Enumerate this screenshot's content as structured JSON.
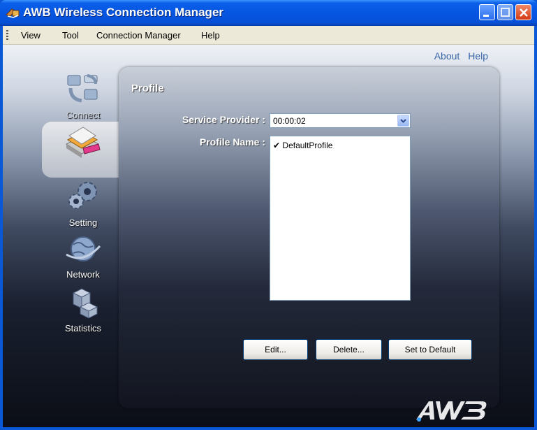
{
  "window": {
    "title": "AWB Wireless Connection Manager",
    "title_icon": "app-icon"
  },
  "menu": {
    "items": [
      "View",
      "Tool",
      "Connection Manager",
      "Help"
    ]
  },
  "toplinks": {
    "about": "About",
    "help": "Help"
  },
  "nav": {
    "items": [
      {
        "label": "Connect",
        "icon": "connect-icon"
      },
      {
        "label": "",
        "icon": "profile-icon",
        "selected": true
      },
      {
        "label": "Setting",
        "icon": "gear-icon"
      },
      {
        "label": "Network",
        "icon": "globe-icon"
      },
      {
        "label": "Statistics",
        "icon": "statistics-icon"
      }
    ]
  },
  "panel": {
    "title": "Profile",
    "service_provider_label": "Service Provider :",
    "service_provider_value": "00:00:02",
    "profile_name_label": "Profile Name :",
    "profiles": [
      "DefaultProfile"
    ],
    "checkmark": "✔"
  },
  "buttons": {
    "edit": "Edit...",
    "delete": "Delete...",
    "set_default": "Set to Default"
  },
  "colors": {
    "titlebar": "#0656e2",
    "link": "#3b67a8"
  }
}
